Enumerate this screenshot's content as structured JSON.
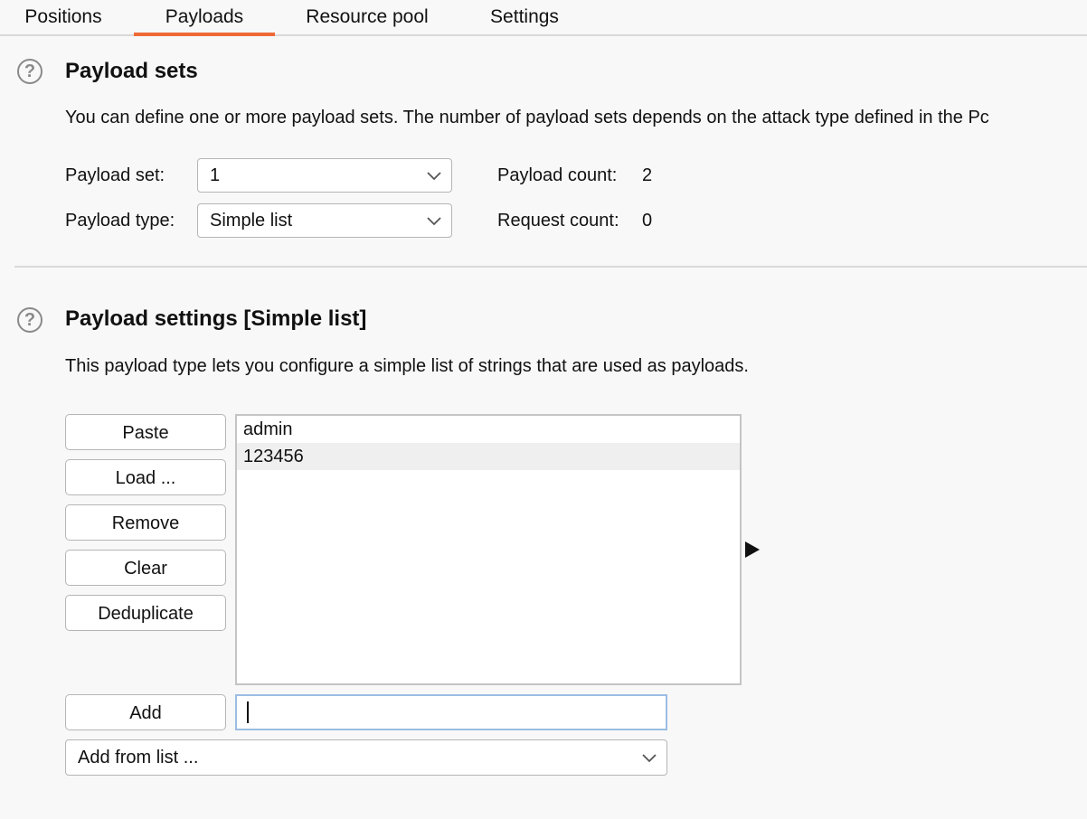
{
  "tabs": [
    {
      "label": "Positions",
      "active": false
    },
    {
      "label": "Payloads",
      "active": true
    },
    {
      "label": "Resource pool",
      "active": false
    },
    {
      "label": "Settings",
      "active": false
    }
  ],
  "accent_color": "#ee6a37",
  "payload_sets": {
    "title": "Payload sets",
    "description": "You can define one or more payload sets. The number of payload sets depends on the attack type defined in the Pc",
    "payload_set_label": "Payload set:",
    "payload_set_value": "1",
    "payload_type_label": "Payload type:",
    "payload_type_value": "Simple list",
    "payload_count_label": "Payload count:",
    "payload_count_value": "2",
    "request_count_label": "Request count:",
    "request_count_value": "0"
  },
  "payload_settings": {
    "title": "Payload settings [Simple list]",
    "description": "This payload type lets you configure a simple list of strings that are used as payloads.",
    "buttons": {
      "paste": "Paste",
      "load": "Load ...",
      "remove": "Remove",
      "clear": "Clear",
      "deduplicate": "Deduplicate",
      "add": "Add"
    },
    "items": [
      "admin",
      "123456"
    ],
    "selected_index": 1,
    "add_input_value": "",
    "add_from_list_label": "Add from list ..."
  }
}
